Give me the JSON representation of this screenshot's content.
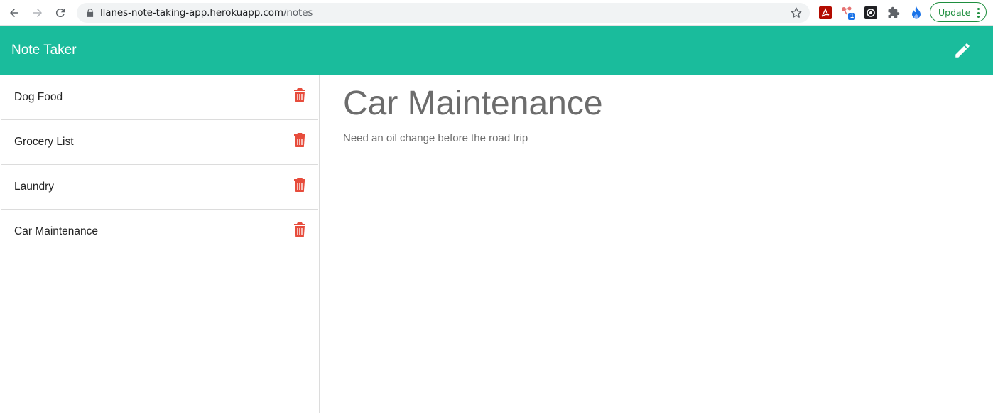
{
  "browser": {
    "url_host": "llanes-note-taking-app.herokuapp.com",
    "url_path": "/notes",
    "update_label": "Update",
    "extension_badge": "1"
  },
  "header": {
    "brand": "Note Taker",
    "new_note_icon": "pencil-icon"
  },
  "notes": [
    {
      "title": "Dog Food"
    },
    {
      "title": "Grocery List"
    },
    {
      "title": "Laundry"
    },
    {
      "title": "Car Maintenance"
    }
  ],
  "active_note": {
    "title": "Car Maintenance",
    "text": "Need an oil change before the road trip"
  },
  "colors": {
    "header": "#1abc9c",
    "delete": "#e74c3c",
    "note_text": "#6c6c6c"
  }
}
